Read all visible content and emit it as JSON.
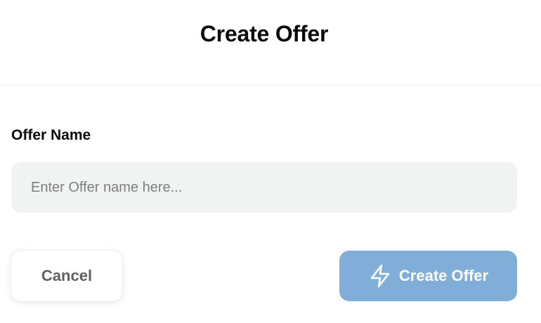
{
  "dialog": {
    "title": "Create Offer"
  },
  "form": {
    "offer_name_label": "Offer Name",
    "offer_name_placeholder": "Enter Offer name here...",
    "offer_name_value": ""
  },
  "actions": {
    "cancel_label": "Cancel",
    "create_label": "Create Offer",
    "create_icon": "lightning-bolt-icon"
  },
  "colors": {
    "primary_button": "#80aed9",
    "input_background": "#f1f3f2",
    "title_text": "#0b0b0b",
    "cancel_text": "#5e6162"
  }
}
